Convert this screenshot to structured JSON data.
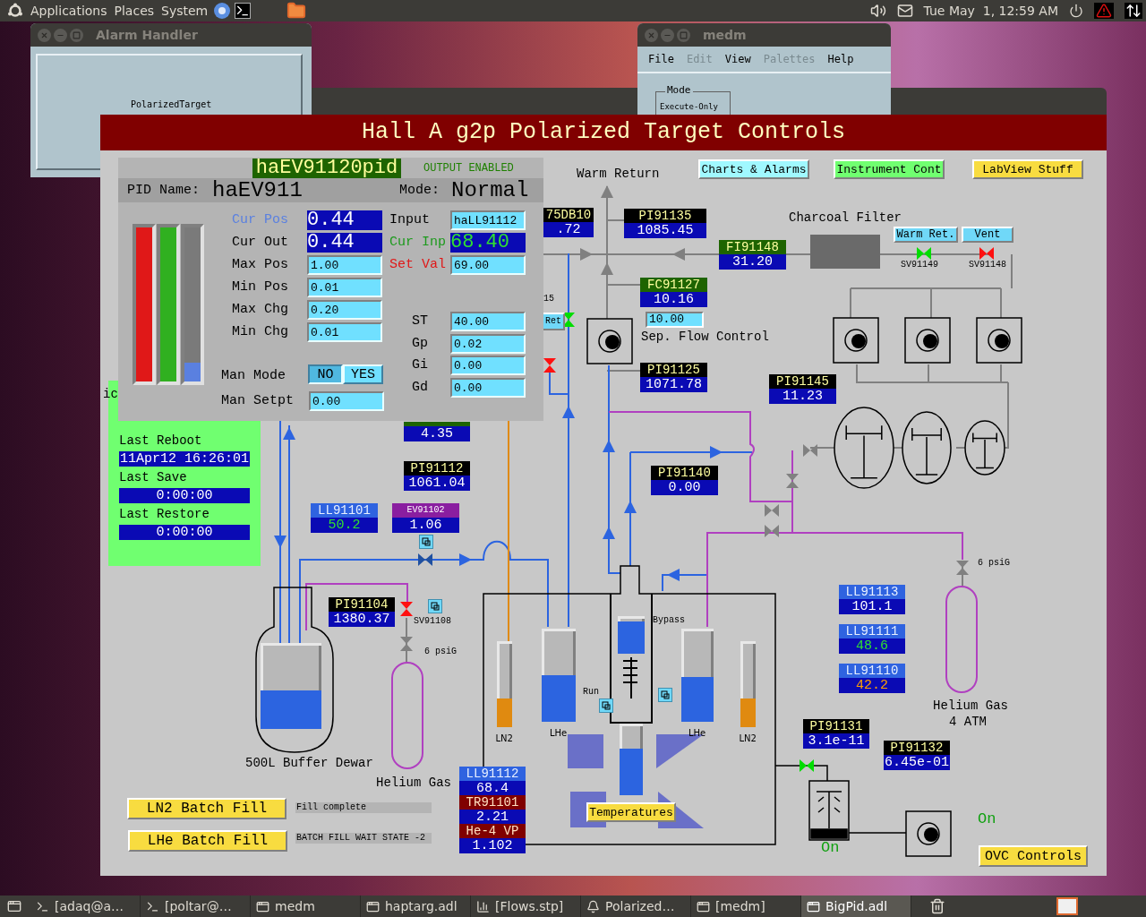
{
  "top_panel": {
    "menus": [
      "Applications",
      "Places",
      "System"
    ],
    "clock": "Tue May  1, 12:59 AM"
  },
  "alarm_handler": {
    "title": "Alarm Handler",
    "group": "PolarizedTarget"
  },
  "medm": {
    "title": "medm",
    "menu": [
      {
        "label": "File",
        "disabled": false
      },
      {
        "label": "Edit",
        "disabled": true
      },
      {
        "label": "View",
        "disabled": false
      },
      {
        "label": "Palettes",
        "disabled": true
      },
      {
        "label": "Help",
        "disabled": false
      }
    ],
    "mode_label": "Mode",
    "mode": "Execute-Only"
  },
  "display": {
    "title": "Hall A g2p Polarized Target Controls",
    "nav_buttons": [
      {
        "label": "Charts & Alarms",
        "color": "#a0f8ff"
      },
      {
        "label": "Instrument Cont",
        "color": "#70ff70"
      },
      {
        "label": "LabView Stuff",
        "color": "#f8dc40"
      }
    ],
    "labels": [
      {
        "kind": "title",
        "text": "Warm Return"
      },
      {
        "kind": "title",
        "text": "Charcoal Filter"
      },
      {
        "kind": "tag",
        "text": "SV91149"
      },
      {
        "kind": "tag",
        "text": "SV91148"
      },
      {
        "kind": "tag",
        "text": "15"
      },
      {
        "kind": "title",
        "text": "Sep. Flow Control"
      },
      {
        "kind": "title",
        "text": "ic"
      },
      {
        "kind": "tag",
        "text": "6 psiG"
      },
      {
        "kind": "tag",
        "text": "SV91108"
      },
      {
        "kind": "tag",
        "text": "6 psiG"
      },
      {
        "kind": "tag",
        "text": "Bypass"
      },
      {
        "kind": "tag",
        "text": "Run"
      },
      {
        "kind": "title",
        "text": "Helium Gas"
      },
      {
        "kind": "title",
        "text": "4 ATM"
      },
      {
        "kind": "title",
        "text": "500L Buffer Dewar"
      },
      {
        "kind": "title",
        "text": "Helium Gas"
      },
      {
        "kind": "status",
        "text": "On"
      },
      {
        "kind": "status",
        "text": "On"
      }
    ],
    "readouts": [
      {
        "kind": "pressure",
        "label": "75DB10",
        "value": ".72",
        "alarm_sensitive": false,
        "minor_alarm": false
      },
      {
        "kind": "pressure",
        "label": "PI91135",
        "value": "1085.45",
        "alarm_sensitive": false,
        "minor_alarm": false
      },
      {
        "kind": "flow",
        "label": "FI91148",
        "value": "31.20",
        "alarm_sensitive": false,
        "minor_alarm": false
      },
      {
        "kind": "flow",
        "label": "FC91127",
        "value": "10.16",
        "alarm_sensitive": false,
        "minor_alarm": false
      },
      {
        "kind": "pressure",
        "label": "PI91125",
        "value": "1071.78",
        "alarm_sensitive": false,
        "minor_alarm": false
      },
      {
        "kind": "pressure",
        "label": "PI91145",
        "value": "11.23",
        "alarm_sensitive": false,
        "minor_alarm": false
      },
      {
        "kind": "flow",
        "value": "4.35",
        "alarm_sensitive": false,
        "minor_alarm": false
      },
      {
        "kind": "pressure",
        "label": "PI91112",
        "value": "1061.04",
        "alarm_sensitive": false,
        "minor_alarm": false
      },
      {
        "kind": "pressure",
        "label": "PI91140",
        "value": "0.00",
        "alarm_sensitive": false,
        "minor_alarm": false
      },
      {
        "kind": "level",
        "label": "LL91101",
        "value": "50.2",
        "alarm_sensitive": true,
        "minor_alarm": false
      },
      {
        "kind": "valve",
        "label": "EV91102",
        "value": "1.06",
        "alarm_sensitive": false,
        "minor_alarm": false
      },
      {
        "kind": "pressure",
        "label": "PI91104",
        "value": "1380.37",
        "alarm_sensitive": false,
        "minor_alarm": false
      },
      {
        "kind": "level",
        "label": "LL91113",
        "value": "101.1",
        "alarm_sensitive": false,
        "minor_alarm": false
      },
      {
        "kind": "level",
        "label": "LL91111",
        "value": "48.6",
        "alarm_sensitive": true,
        "minor_alarm": false
      },
      {
        "kind": "level",
        "label": "LL91110",
        "value": "42.2",
        "alarm_sensitive": true,
        "minor_alarm": true
      },
      {
        "kind": "pressure",
        "label": "PI91131",
        "value": "3.1e-11",
        "alarm_sensitive": false,
        "minor_alarm": false
      },
      {
        "kind": "pressure",
        "label": "PI91132",
        "value": "6.45e-01",
        "alarm_sensitive": false,
        "minor_alarm": false
      },
      {
        "kind": "level",
        "label": "LL91112",
        "value": "68.4",
        "alarm_sensitive": false,
        "minor_alarm": false
      },
      {
        "kind": "temp",
        "label": "TR91101",
        "value": "2.21",
        "alarm_sensitive": false,
        "minor_alarm": false
      },
      {
        "kind": "temp",
        "label": "He-4 VP",
        "value": "1.102",
        "alarm_sensitive": false,
        "minor_alarm": false
      }
    ],
    "gauges": [
      {
        "label": "LN2",
        "level": 0.33,
        "color": "#e08a10"
      },
      {
        "label": "LHe",
        "level": 0.5,
        "color": "#2c64e0"
      },
      {
        "level": 0.85,
        "color": "#2c64e0"
      },
      {
        "level": 0.65,
        "color": "#2c64e0"
      },
      {
        "label": "LHe",
        "level": 0.48,
        "color": "#2c64e0"
      },
      {
        "label": "LN2",
        "level": 0.33,
        "color": "#e08a10"
      },
      {
        "level": 0.45,
        "color": "#2c64e0"
      }
    ],
    "valves": [
      {
        "open": true
      },
      {
        "open": false
      },
      {
        "open": true
      },
      {
        "open": false
      },
      {
        "open": false
      },
      {
        "open": true
      }
    ],
    "buttons": [
      {
        "label": "Warm Ret.",
        "color": "#70d8f8"
      },
      {
        "label": "Vent",
        "color": "#70d8f8"
      },
      {
        "label": "Ret",
        "color": "#70d8f8"
      },
      {
        "label": "Temperatures",
        "color": "#f8dc40"
      },
      {
        "label": "LN2 Batch Fill",
        "color": "#f8dc40"
      },
      {
        "label": "LHe Batch Fill",
        "color": "#f8dc40"
      },
      {
        "label": "OVC Controls",
        "color": "#f8dc40"
      }
    ],
    "setpoint": "10.00",
    "status_texts": [
      "Fill complete",
      "BATCH FILL WAIT STATE -2"
    ],
    "info_panel": [
      {
        "label": "Last Reboot",
        "value": "11Apr12 16:26:01"
      },
      {
        "label": "Last Save",
        "value": "0:00:00"
      },
      {
        "label": "Last Restore",
        "value": "0:00:00"
      }
    ],
    "pid": {
      "record": "haEV91120pid",
      "output": "OUTPUT ENABLED",
      "name_label": "PID Name:",
      "name": "haEV911",
      "mode_label": "Mode:",
      "mode": "Normal",
      "bars": [
        {
          "color": "#e01818",
          "level": 1
        },
        {
          "color": "#30b020",
          "level": 1
        },
        {
          "color": "#5a80e0",
          "level": 0.12
        }
      ],
      "fields": [
        {
          "kind": "position",
          "label": "Cur Pos",
          "value": "0.44"
        },
        {
          "kind": "entry",
          "label": "Input",
          "value": "haLL91112"
        },
        {
          "kind": "readback",
          "label": "Cur Out",
          "value": "0.44"
        },
        {
          "kind": "input",
          "label": "Cur Inp",
          "value": "68.40"
        },
        {
          "kind": "entry",
          "label": "Max Pos",
          "value": "1.00"
        },
        {
          "kind": "setpoint",
          "label": "Set Val",
          "value": "69.00"
        },
        {
          "kind": "entry",
          "label": "Min Pos",
          "value": "0.01"
        },
        {
          "kind": "entry",
          "label": "Max Chg",
          "value": "0.20"
        },
        {
          "kind": "entry",
          "label": "ST",
          "value": "40.00"
        },
        {
          "kind": "entry",
          "label": "Min Chg",
          "value": "0.01"
        },
        {
          "kind": "entry",
          "label": "Gp",
          "value": "0.02"
        },
        {
          "kind": "entry",
          "label": "Gi",
          "value": "0.00"
        },
        {
          "kind": "entry",
          "label": "Gd",
          "value": "0.00"
        },
        {
          "kind": "entry",
          "label": "Man Setpt",
          "value": "0.00"
        }
      ],
      "man_mode": {
        "label": "Man Mode",
        "options": [
          {
            "label": "NO",
            "selected": true
          },
          {
            "label": "YES",
            "selected": false
          }
        ]
      }
    }
  },
  "taskbar": [
    {
      "kind": "terminal",
      "label": "[adaq@a…",
      "selected": false
    },
    {
      "kind": "terminal",
      "label": "[poltar@…",
      "selected": false
    },
    {
      "kind": "window",
      "label": "medm",
      "selected": false
    },
    {
      "kind": "window",
      "label": "haptarg.adl",
      "selected": false
    },
    {
      "kind": "chart",
      "label": "[Flows.stp]",
      "selected": false
    },
    {
      "kind": "alarm",
      "label": "Polarized…",
      "selected": false
    },
    {
      "kind": "window",
      "label": "[medm]",
      "selected": false
    },
    {
      "kind": "window",
      "label": "BigPid.adl",
      "selected": true
    }
  ]
}
